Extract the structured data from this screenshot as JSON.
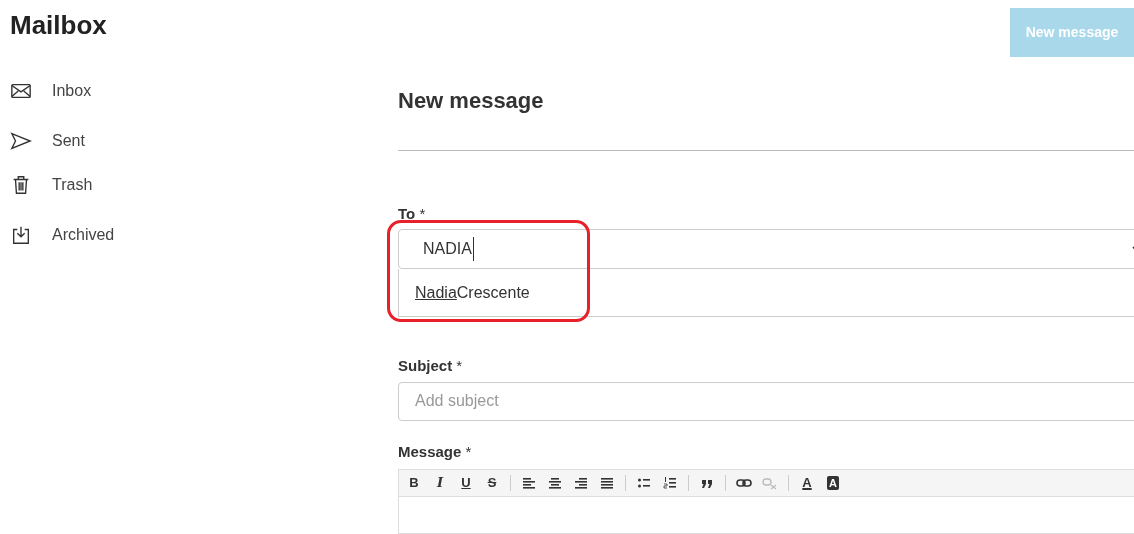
{
  "app": {
    "title": "Mailbox"
  },
  "new_message_button": {
    "label": "New message",
    "disabled": true
  },
  "sidebar": {
    "items": [
      {
        "kind": "inbox",
        "label": "Inbox"
      },
      {
        "kind": "sent",
        "label": "Sent"
      },
      {
        "kind": "trash",
        "label": "Trash"
      },
      {
        "kind": "archived",
        "label": "Archived"
      }
    ]
  },
  "form": {
    "title": "New message",
    "to": {
      "label": "To",
      "required_mark": "*",
      "value": "NADIA",
      "expanded": true,
      "suggestions": [
        {
          "match": "Nadia",
          "rest": "Crescente"
        }
      ]
    },
    "subject": {
      "label": "Subject",
      "required_mark": "*",
      "placeholder": "Add subject"
    },
    "message": {
      "label": "Message",
      "required_mark": "*",
      "toolbar": [
        {
          "kind": "bold",
          "label": "B",
          "disabled": false
        },
        {
          "kind": "italic",
          "label": "I",
          "disabled": false
        },
        {
          "kind": "underline",
          "label": "U",
          "disabled": false
        },
        {
          "kind": "strike",
          "label": "S",
          "disabled": false
        },
        {
          "kind": "separator"
        },
        {
          "kind": "align-left",
          "disabled": false
        },
        {
          "kind": "align-center",
          "disabled": false
        },
        {
          "kind": "align-right",
          "disabled": false
        },
        {
          "kind": "align-justify",
          "disabled": false
        },
        {
          "kind": "separator"
        },
        {
          "kind": "bullet-list",
          "disabled": false
        },
        {
          "kind": "numbered-list",
          "disabled": false
        },
        {
          "kind": "separator"
        },
        {
          "kind": "quote",
          "disabled": false
        },
        {
          "kind": "separator"
        },
        {
          "kind": "link",
          "disabled": false
        },
        {
          "kind": "unlink",
          "disabled": true
        },
        {
          "kind": "separator"
        },
        {
          "kind": "text-color",
          "label": "A",
          "disabled": false
        },
        {
          "kind": "background-color",
          "label": "A",
          "disabled": false
        }
      ]
    }
  },
  "annotation": {
    "color": "#e8202a"
  }
}
